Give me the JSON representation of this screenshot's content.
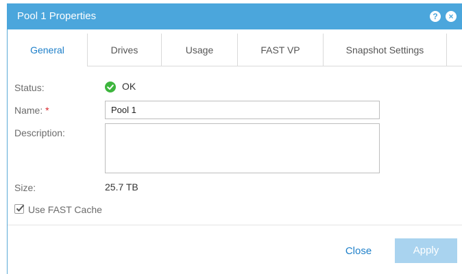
{
  "dialog": {
    "title": "Pool 1 Properties",
    "help_icon": "?",
    "close_icon": "×"
  },
  "tabs": [
    {
      "label": "General",
      "active": true
    },
    {
      "label": "Drives",
      "active": false
    },
    {
      "label": "Usage",
      "active": false
    },
    {
      "label": "FAST VP",
      "active": false
    },
    {
      "label": "Snapshot Settings",
      "active": false
    }
  ],
  "form": {
    "status_label": "Status:",
    "status_value": "OK",
    "status_icon": "check-circle-icon",
    "name_label": "Name:",
    "required_marker": "*",
    "name_value": "Pool 1",
    "description_label": "Description:",
    "description_value": "",
    "size_label": "Size:",
    "size_value": "25.7 TB",
    "fast_cache_label": "Use FAST Cache",
    "fast_cache_checked": true
  },
  "footer": {
    "close_label": "Close",
    "apply_label": "Apply"
  },
  "colors": {
    "titlebar": "#4ba6dc",
    "accent": "#1d7fc9",
    "ok_green": "#3db53d",
    "apply_disabled": "#a9d3ef"
  }
}
